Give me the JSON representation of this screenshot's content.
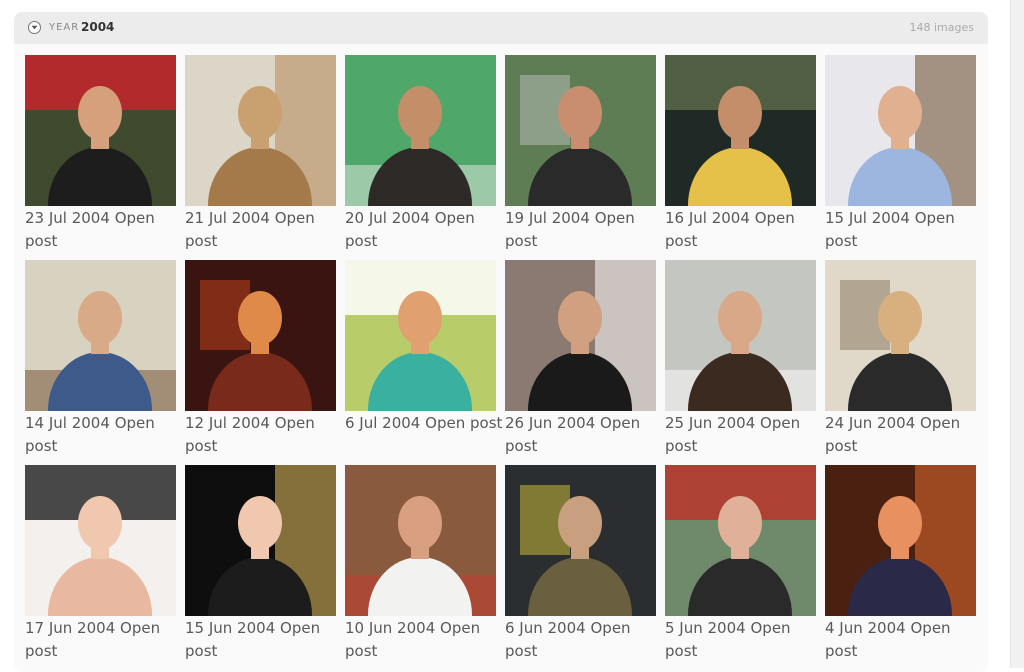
{
  "header": {
    "year_label": "YEAR",
    "year_value": "2004",
    "count": "148 images"
  },
  "posts": [
    {
      "date": "23 Jul 2004",
      "action": "Open",
      "trail": "post",
      "bg": "#3f4a2e",
      "accent": "#c8242b",
      "figure": "#1d1d1d",
      "skin": "#d6a07c"
    },
    {
      "date": "21 Jul 2004",
      "action": "Open",
      "trail": "post",
      "bg": "#dcd6c8",
      "accent": "#b58a5a",
      "figure": "#a57a4a",
      "skin": "#c9a070"
    },
    {
      "date": "20 Jul 2004",
      "action": "Open",
      "trail": "post",
      "bg": "#4fa86a",
      "accent": "#e9ece6",
      "figure": "#2e2a28",
      "skin": "#c48e68"
    },
    {
      "date": "19 Jul 2004",
      "action": "Open",
      "trail": "post",
      "bg": "#5e7d55",
      "accent": "#c9c9c9",
      "figure": "#2a2a2a",
      "skin": "#c98e70"
    },
    {
      "date": "16 Jul 2004",
      "action": "Open",
      "trail": "post",
      "bg": "#1f2a26",
      "accent": "#5a6a4a",
      "figure": "#e6c14a",
      "skin": "#c48e6a"
    },
    {
      "date": "15 Jul 2004",
      "action": "Open",
      "trail": "post",
      "bg": "#e8e8ec",
      "accent": "#6a4a2a",
      "figure": "#9cb6e0",
      "skin": "#e0b090"
    },
    {
      "date": "14 Jul 2004",
      "action": "Open",
      "trail": "post",
      "bg": "#d8d2c0",
      "accent": "#6b4a2e",
      "figure": "#3e5a8a",
      "skin": "#d8aa88"
    },
    {
      "date": "12 Jul 2004",
      "action": "Open",
      "trail": "post",
      "bg": "#3a1410",
      "accent": "#d84a20",
      "figure": "#7a2a1a",
      "skin": "#e08a4a"
    },
    {
      "date": "6 Jul 2004",
      "action": "Open",
      "trail": "post",
      "bg": "#b8cc6a",
      "accent": "#ffffff",
      "figure": "#3ab0a0",
      "skin": "#e0a070"
    },
    {
      "date": "26 Jun 2004",
      "action": "Open",
      "trail": "post",
      "bg": "#8a7a72",
      "accent": "#ffffff",
      "figure": "#1a1a1a",
      "skin": "#d0a080"
    },
    {
      "date": "25 Jun 2004",
      "action": "Open",
      "trail": "post",
      "bg": "#c4c6c2",
      "accent": "#ffffff",
      "figure": "#3a2a20",
      "skin": "#d8a888"
    },
    {
      "date": "24 Jun 2004",
      "action": "Open",
      "trail": "post",
      "bg": "#e0d8c8",
      "accent": "#7a6a50",
      "figure": "#2a2a2a",
      "skin": "#d8b080"
    },
    {
      "date": "17 Jun 2004",
      "action": "Open",
      "trail": "post",
      "bg": "#f4f0ee",
      "accent": "#2a2a2a",
      "figure": "#e8b8a0",
      "skin": "#f0c8b0"
    },
    {
      "date": "15 Jun 2004",
      "action": "Open",
      "trail": "post",
      "bg": "#0e0e0e",
      "accent": "#e8c060",
      "figure": "#1c1c1c",
      "skin": "#f0c8b0"
    },
    {
      "date": "10 Jun 2004",
      "action": "Open",
      "trail": "post",
      "bg": "#8a5a3e",
      "accent": "#c8382e",
      "figure": "#f2f2f0",
      "skin": "#d8a080"
    },
    {
      "date": "6 Jun 2004",
      "action": "Open",
      "trail": "post",
      "bg": "#2a2e30",
      "accent": "#e8d63a",
      "figure": "#6a6040",
      "skin": "#c8a080"
    },
    {
      "date": "5 Jun 2004",
      "action": "Open",
      "trail": "post",
      "bg": "#6e8a6a",
      "accent": "#b8342a",
      "figure": "#2a2a2a",
      "skin": "#e0b098"
    },
    {
      "date": "4 Jun 2004",
      "action": "Open",
      "trail": "post",
      "bg": "#4a2010",
      "accent": "#e06a30",
      "figure": "#2a2a48",
      "skin": "#e89060"
    }
  ]
}
